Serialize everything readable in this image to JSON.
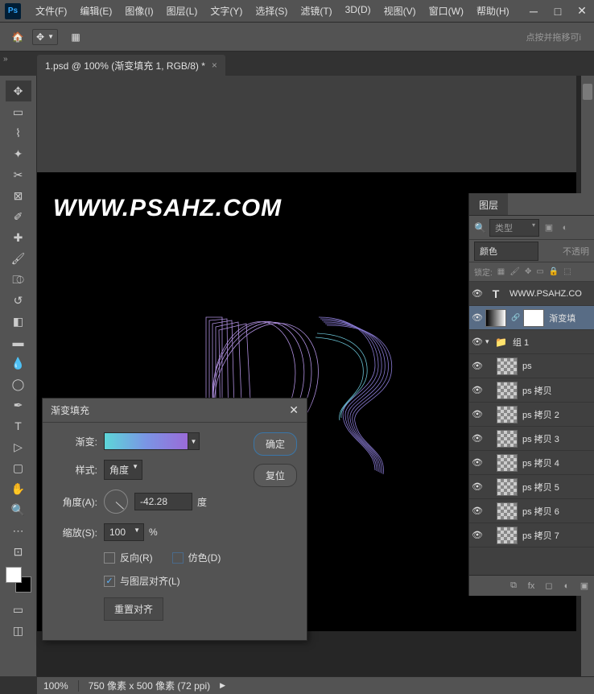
{
  "app": {
    "logo": "Ps"
  },
  "menu": [
    "文件(F)",
    "编辑(E)",
    "图像(I)",
    "图层(L)",
    "文字(Y)",
    "选择(S)",
    "滤镜(T)",
    "3D(D)",
    "视图(V)",
    "窗口(W)",
    "帮助(H)"
  ],
  "options": {
    "hint": "点按并拖移可i"
  },
  "tab": {
    "label": "1.psd @ 100% (渐变填充 1, RGB/8) *"
  },
  "canvas": {
    "watermark": "WWW.PSAHZ.COM"
  },
  "dialog": {
    "title": "渐变填充",
    "labels": {
      "gradient": "渐变:",
      "style": "样式:",
      "angle": "角度(A):",
      "scale": "缩放(S):",
      "degree": "度",
      "percent": "%",
      "reverse": "反向(R)",
      "dither": "仿色(D)",
      "align": "与图层对齐(L)",
      "reset_align": "重置对齐"
    },
    "values": {
      "style": "角度",
      "angle": "-42.28",
      "scale": "100",
      "reverse": false,
      "dither": false,
      "align": true
    },
    "buttons": {
      "ok": "确定",
      "cancel": "复位"
    }
  },
  "layers_panel": {
    "tab": "图层",
    "filter_label": "类型",
    "blend_mode": "颜色",
    "opacity_label": "不透明",
    "lock_label": "锁定:",
    "layers": [
      {
        "type": "text",
        "name": "WWW.PSAHZ.CO",
        "vis": true,
        "indent": 0
      },
      {
        "type": "adjust",
        "name": "渐变填",
        "vis": true,
        "indent": 0,
        "selected": true
      },
      {
        "type": "group",
        "name": "组 1",
        "vis": true,
        "indent": 0,
        "expanded": true
      },
      {
        "type": "normal",
        "name": "ps",
        "vis": true,
        "indent": 1
      },
      {
        "type": "normal",
        "name": "ps 拷贝",
        "vis": true,
        "indent": 1
      },
      {
        "type": "normal",
        "name": "ps 拷贝 2",
        "vis": true,
        "indent": 1
      },
      {
        "type": "normal",
        "name": "ps 拷贝 3",
        "vis": true,
        "indent": 1
      },
      {
        "type": "normal",
        "name": "ps 拷贝 4",
        "vis": true,
        "indent": 1
      },
      {
        "type": "normal",
        "name": "ps 拷贝 5",
        "vis": true,
        "indent": 1
      },
      {
        "type": "normal",
        "name": "ps 拷贝 6",
        "vis": true,
        "indent": 1
      },
      {
        "type": "normal",
        "name": "ps 拷贝 7",
        "vis": true,
        "indent": 1
      }
    ]
  },
  "status": {
    "zoom": "100%",
    "dimensions": "750 像素 x 500 像素 (72 ppi)"
  }
}
